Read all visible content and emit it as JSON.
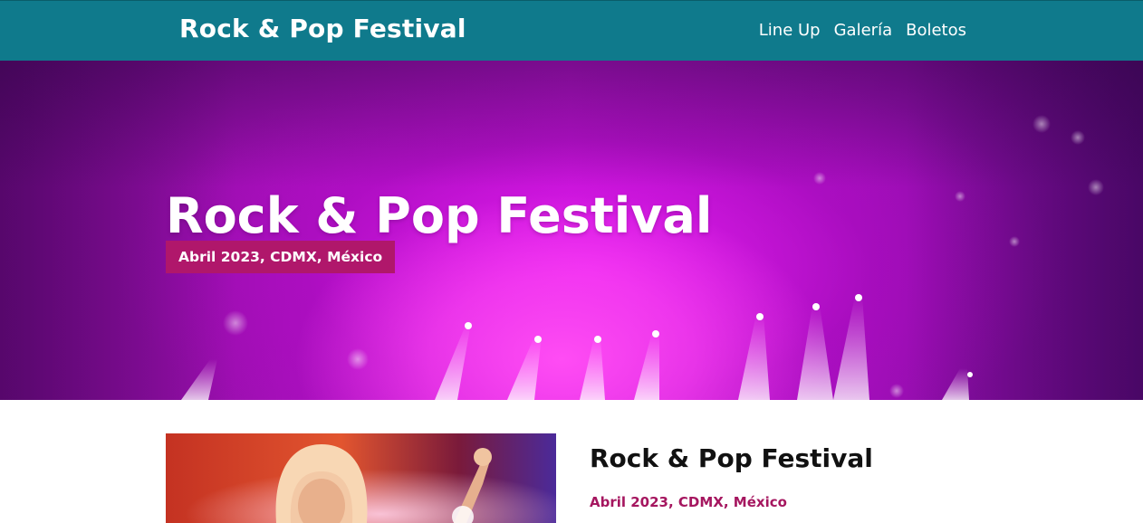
{
  "header": {
    "brand": "Rock & Pop Festival",
    "nav": [
      "Line Up",
      "Galería",
      "Boletos"
    ]
  },
  "hero": {
    "title": "Rock & Pop Festival",
    "badge": "Abril 2023, CDMX, México"
  },
  "content": {
    "title": "Rock & Pop Festival",
    "subtitle": "Abril 2023, CDMX, México"
  },
  "colors": {
    "header_bg": "#0f7a8c",
    "badge_bg": "#b0176b",
    "accent_text": "#a5165f",
    "hero_tint": "#c414d8"
  }
}
